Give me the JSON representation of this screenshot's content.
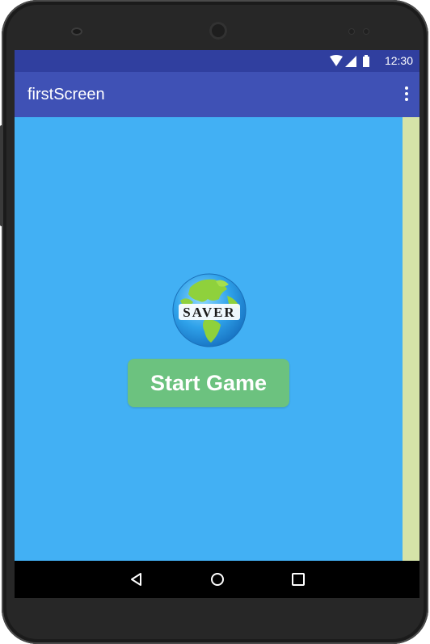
{
  "status_bar": {
    "time": "12:30",
    "icons": [
      "wifi-icon",
      "signal-icon",
      "battery-icon"
    ]
  },
  "app_bar": {
    "title": "firstScreen",
    "menu_icon": "overflow-menu-icon"
  },
  "main": {
    "logo_text": "SAVER",
    "start_button_label": "Start Game"
  },
  "nav_bar": {
    "icons": [
      "back-icon",
      "home-icon",
      "recents-icon"
    ]
  },
  "colors": {
    "status_bar": "#303f9f",
    "app_bar": "#3f51b5",
    "content_bg": "#42b0f4",
    "button": "#6cc27f",
    "right_strip": "#d5e3a8"
  }
}
